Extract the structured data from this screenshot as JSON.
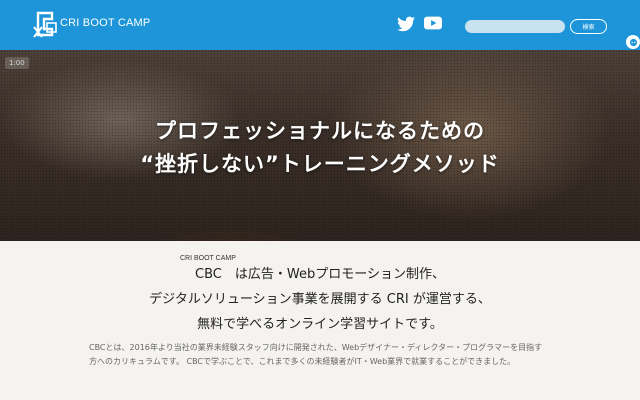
{
  "header": {
    "brand": "CRI BOOT CAMP",
    "search_placeholder": "",
    "search_button": "検索",
    "icons": [
      "logo-icon",
      "twitter-icon",
      "youtube-icon",
      "side-circle-icon"
    ],
    "bg_color": "#1d95d8"
  },
  "hero": {
    "video_time": "1:00",
    "title_line1": "プロフェッショナルになるための",
    "title_line2": "“挫折しない”トレーニングメソッド"
  },
  "intro": {
    "ruby": "CRI BOOT CAMP",
    "lead1": "CBC　は広告・Webプロモーション制作、",
    "lead2": "デジタルソリューション事業を展開する CRI が運営する、",
    "lead3": "無料で学べるオンライン学習サイトです。",
    "body": "CBCとは、2016年より当社の業界未経験スタッフ向けに開発された、Webデザイナー・ディレクター・プログラマーを目指す方へのカリキュラムです。 CBCで学ぶことで、これまで多くの未経験者がIT・Web業界で就業することができました。"
  }
}
